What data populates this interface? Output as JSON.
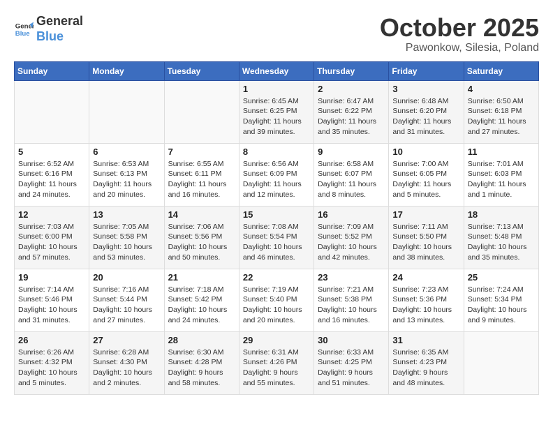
{
  "logo": {
    "line1": "General",
    "line2": "Blue"
  },
  "title": "October 2025",
  "location": "Pawonkow, Silesia, Poland",
  "days_header": [
    "Sunday",
    "Monday",
    "Tuesday",
    "Wednesday",
    "Thursday",
    "Friday",
    "Saturday"
  ],
  "weeks": [
    [
      {
        "day": "",
        "content": ""
      },
      {
        "day": "",
        "content": ""
      },
      {
        "day": "",
        "content": ""
      },
      {
        "day": "1",
        "content": "Sunrise: 6:45 AM\nSunset: 6:25 PM\nDaylight: 11 hours\nand 39 minutes."
      },
      {
        "day": "2",
        "content": "Sunrise: 6:47 AM\nSunset: 6:22 PM\nDaylight: 11 hours\nand 35 minutes."
      },
      {
        "day": "3",
        "content": "Sunrise: 6:48 AM\nSunset: 6:20 PM\nDaylight: 11 hours\nand 31 minutes."
      },
      {
        "day": "4",
        "content": "Sunrise: 6:50 AM\nSunset: 6:18 PM\nDaylight: 11 hours\nand 27 minutes."
      }
    ],
    [
      {
        "day": "5",
        "content": "Sunrise: 6:52 AM\nSunset: 6:16 PM\nDaylight: 11 hours\nand 24 minutes."
      },
      {
        "day": "6",
        "content": "Sunrise: 6:53 AM\nSunset: 6:13 PM\nDaylight: 11 hours\nand 20 minutes."
      },
      {
        "day": "7",
        "content": "Sunrise: 6:55 AM\nSunset: 6:11 PM\nDaylight: 11 hours\nand 16 minutes."
      },
      {
        "day": "8",
        "content": "Sunrise: 6:56 AM\nSunset: 6:09 PM\nDaylight: 11 hours\nand 12 minutes."
      },
      {
        "day": "9",
        "content": "Sunrise: 6:58 AM\nSunset: 6:07 PM\nDaylight: 11 hours\nand 8 minutes."
      },
      {
        "day": "10",
        "content": "Sunrise: 7:00 AM\nSunset: 6:05 PM\nDaylight: 11 hours\nand 5 minutes."
      },
      {
        "day": "11",
        "content": "Sunrise: 7:01 AM\nSunset: 6:03 PM\nDaylight: 11 hours\nand 1 minute."
      }
    ],
    [
      {
        "day": "12",
        "content": "Sunrise: 7:03 AM\nSunset: 6:00 PM\nDaylight: 10 hours\nand 57 minutes."
      },
      {
        "day": "13",
        "content": "Sunrise: 7:05 AM\nSunset: 5:58 PM\nDaylight: 10 hours\nand 53 minutes."
      },
      {
        "day": "14",
        "content": "Sunrise: 7:06 AM\nSunset: 5:56 PM\nDaylight: 10 hours\nand 50 minutes."
      },
      {
        "day": "15",
        "content": "Sunrise: 7:08 AM\nSunset: 5:54 PM\nDaylight: 10 hours\nand 46 minutes."
      },
      {
        "day": "16",
        "content": "Sunrise: 7:09 AM\nSunset: 5:52 PM\nDaylight: 10 hours\nand 42 minutes."
      },
      {
        "day": "17",
        "content": "Sunrise: 7:11 AM\nSunset: 5:50 PM\nDaylight: 10 hours\nand 38 minutes."
      },
      {
        "day": "18",
        "content": "Sunrise: 7:13 AM\nSunset: 5:48 PM\nDaylight: 10 hours\nand 35 minutes."
      }
    ],
    [
      {
        "day": "19",
        "content": "Sunrise: 7:14 AM\nSunset: 5:46 PM\nDaylight: 10 hours\nand 31 minutes."
      },
      {
        "day": "20",
        "content": "Sunrise: 7:16 AM\nSunset: 5:44 PM\nDaylight: 10 hours\nand 27 minutes."
      },
      {
        "day": "21",
        "content": "Sunrise: 7:18 AM\nSunset: 5:42 PM\nDaylight: 10 hours\nand 24 minutes."
      },
      {
        "day": "22",
        "content": "Sunrise: 7:19 AM\nSunset: 5:40 PM\nDaylight: 10 hours\nand 20 minutes."
      },
      {
        "day": "23",
        "content": "Sunrise: 7:21 AM\nSunset: 5:38 PM\nDaylight: 10 hours\nand 16 minutes."
      },
      {
        "day": "24",
        "content": "Sunrise: 7:23 AM\nSunset: 5:36 PM\nDaylight: 10 hours\nand 13 minutes."
      },
      {
        "day": "25",
        "content": "Sunrise: 7:24 AM\nSunset: 5:34 PM\nDaylight: 10 hours\nand 9 minutes."
      }
    ],
    [
      {
        "day": "26",
        "content": "Sunrise: 6:26 AM\nSunset: 4:32 PM\nDaylight: 10 hours\nand 5 minutes."
      },
      {
        "day": "27",
        "content": "Sunrise: 6:28 AM\nSunset: 4:30 PM\nDaylight: 10 hours\nand 2 minutes."
      },
      {
        "day": "28",
        "content": "Sunrise: 6:30 AM\nSunset: 4:28 PM\nDaylight: 9 hours\nand 58 minutes."
      },
      {
        "day": "29",
        "content": "Sunrise: 6:31 AM\nSunset: 4:26 PM\nDaylight: 9 hours\nand 55 minutes."
      },
      {
        "day": "30",
        "content": "Sunrise: 6:33 AM\nSunset: 4:25 PM\nDaylight: 9 hours\nand 51 minutes."
      },
      {
        "day": "31",
        "content": "Sunrise: 6:35 AM\nSunset: 4:23 PM\nDaylight: 9 hours\nand 48 minutes."
      },
      {
        "day": "",
        "content": ""
      }
    ]
  ]
}
